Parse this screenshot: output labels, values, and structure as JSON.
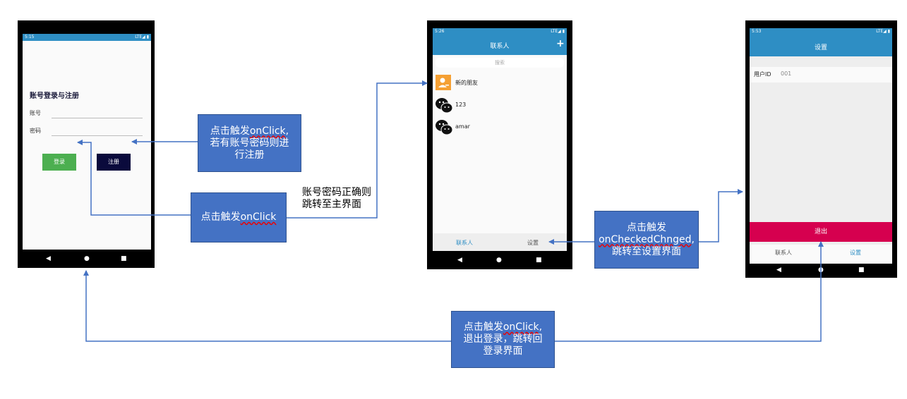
{
  "login_screen": {
    "status_time": "5:15",
    "status_right": "LTE◢ ▮",
    "title": "账号登录与注册",
    "account_label": "账号",
    "password_label": "密码",
    "login_button": "登录",
    "register_button": "注册"
  },
  "contacts_screen": {
    "status_time": "5:26",
    "status_right": "LTE◢ ▮",
    "title": "联系人",
    "add_symbol": "+",
    "search_placeholder": "搜索",
    "items": [
      {
        "label": "新的朋友"
      },
      {
        "label": "123"
      },
      {
        "label": "amar"
      }
    ],
    "tab_contacts": "联系人",
    "tab_settings": "设置"
  },
  "settings_screen": {
    "status_time": "5:53",
    "status_right": "LTE◢ ▮",
    "title": "设置",
    "user_id_label": "用户ID",
    "user_id_value": "001",
    "logout_button": "退出",
    "tab_contacts": "联系人",
    "tab_settings": "设置"
  },
  "nav": {
    "back": "◀",
    "home": "●",
    "recents": "■"
  },
  "notes": {
    "register_line1_pre": "点击触发",
    "register_line1_code": "onClick",
    "register_line1_post": ",",
    "register_line2": "若有账号密码则进",
    "register_line3": "行注册",
    "login_pre": "点击触发",
    "login_code": "onClick",
    "login_success_line1": "账号密码正确则",
    "login_success_line2": "跳转至主界面",
    "settings_line1": "点击触发",
    "settings_line2_code": "onCheckedChnged",
    "settings_line2_post": ",",
    "settings_line3": "跳转至设置界面",
    "logout_line1_pre": "点击触发",
    "logout_line1_code": "onClick",
    "logout_line1_post": ",",
    "logout_line2": "退出登录，跳转回",
    "logout_line3": "登录界面"
  },
  "colors": {
    "note_fill": "#4472c4",
    "arrow": "#4472c4",
    "app_bar": "#2e8ec4",
    "login_green": "#4caf50",
    "register_navy": "#0a0a3c",
    "logout_red": "#d6004f",
    "friend_orange": "#f5a033"
  }
}
